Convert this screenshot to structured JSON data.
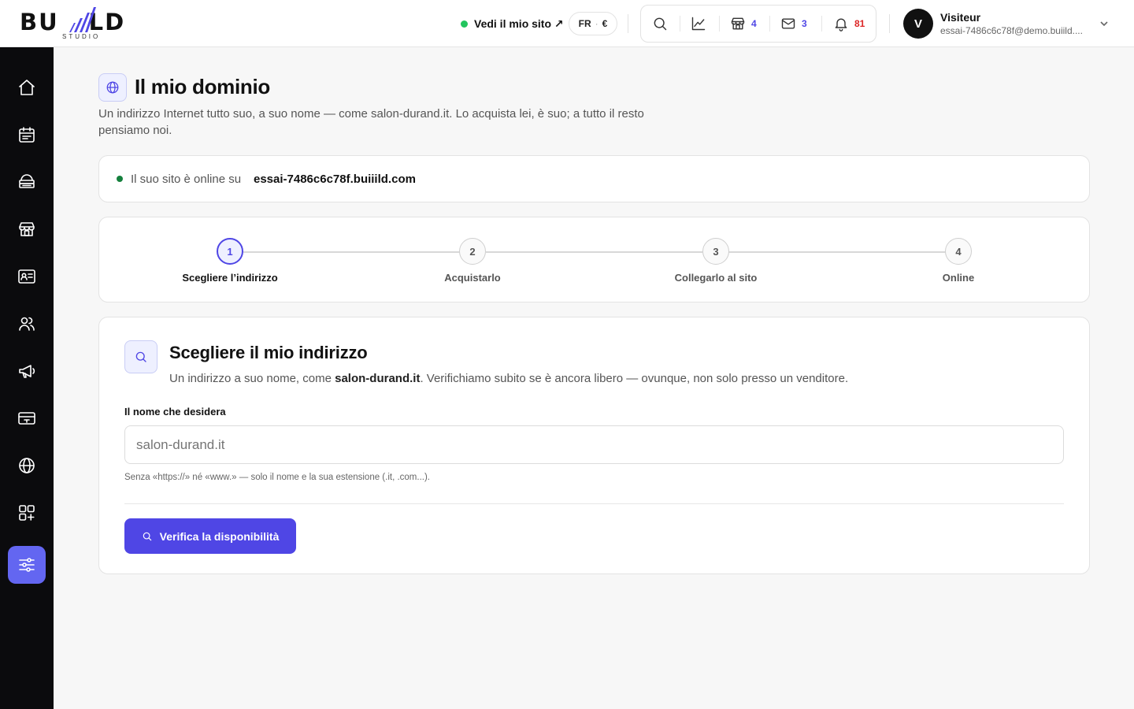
{
  "brand": {
    "name_left": "BU",
    "name_right": "LD",
    "subtitle": "STUDIO"
  },
  "header": {
    "site_link": "Vedi il mio sito ↗",
    "lang": "FR",
    "lang_sep": "·",
    "currency": "€",
    "tools": {
      "shop_count": "4",
      "mail_count": "3",
      "notif_count": "81"
    },
    "user": {
      "initial": "V",
      "name": "Visiteur",
      "email": "essai-7486c6c78f@demo.buiild...."
    }
  },
  "sidebar": {
    "items": [
      {
        "icon": "home-icon"
      },
      {
        "icon": "calendar-icon"
      },
      {
        "icon": "services-icon"
      },
      {
        "icon": "store-icon"
      },
      {
        "icon": "contact-card-icon"
      },
      {
        "icon": "users-icon"
      },
      {
        "icon": "megaphone-icon"
      },
      {
        "icon": "payment-card-icon"
      },
      {
        "icon": "globe-icon"
      },
      {
        "icon": "apps-icon"
      },
      {
        "icon": "settings-sliders-icon",
        "active": true
      }
    ]
  },
  "page": {
    "title": "Il mio dominio",
    "description": "Un indirizzo Internet tutto suo, a suo nome — come salon-durand.it. Lo acquista lei, è suo; a tutto il resto pensiamo noi."
  },
  "status": {
    "label": "Il suo sito è online su",
    "domain": "essai-7486c6c78f.buiiild.com"
  },
  "steps": [
    {
      "number": "1",
      "label": "Scegliere l’indirizzo",
      "active": true
    },
    {
      "number": "2",
      "label": "Acquistarlo"
    },
    {
      "number": "3",
      "label": "Collegarlo al sito"
    },
    {
      "number": "4",
      "label": "Online"
    }
  ],
  "form": {
    "title": "Scegliere il mio indirizzo",
    "desc_before": "Un indirizzo a suo nome, come ",
    "desc_example": "salon-durand.it",
    "desc_after": ". Verifichiamo subito se è ancora libero — ovunque, non solo presso un venditore.",
    "field_label": "Il nome che desidera",
    "field_value": "",
    "field_placeholder": "salon-durand.it",
    "hint": "Senza «https://» né «www.» — solo il nome e la sua estensione (.it, .com...).",
    "button_label": "Verifica la disponibilità"
  },
  "colors": {
    "accent": "#4f46e5",
    "sidebar_active": "#6366f1",
    "online": "#22c55e",
    "alert": "#dc2626"
  }
}
